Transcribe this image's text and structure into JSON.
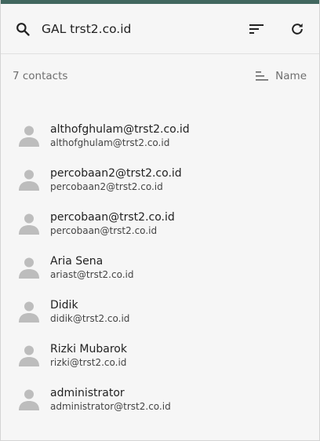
{
  "header": {
    "title": "GAL trst2.co.id",
    "search_icon": "search-icon",
    "sort_icon": "sort-icon",
    "refresh_icon": "refresh-icon"
  },
  "subbar": {
    "count": "7 contacts",
    "sort_label": "Name",
    "sort_icon": "sort-ascending-icon"
  },
  "contacts": [
    {
      "name": "althofghulam@trst2.co.id",
      "email": "althofghulam@trst2.co.id"
    },
    {
      "name": "percobaan2@trst2.co.id",
      "email": "percobaan2@trst2.co.id"
    },
    {
      "name": "percobaan@trst2.co.id",
      "email": "percobaan@trst2.co.id"
    },
    {
      "name": "Aria Sena",
      "email": "ariast@trst2.co.id"
    },
    {
      "name": "Didik",
      "email": "didik@trst2.co.id"
    },
    {
      "name": "Rizki Mubarok",
      "email": "rizki@trst2.co.id"
    },
    {
      "name": "administrator",
      "email": "administrator@trst2.co.id"
    }
  ],
  "colors": {
    "top_strip": "#41675f",
    "avatar": "#bdbdbd",
    "background": "#f6f6f6"
  }
}
